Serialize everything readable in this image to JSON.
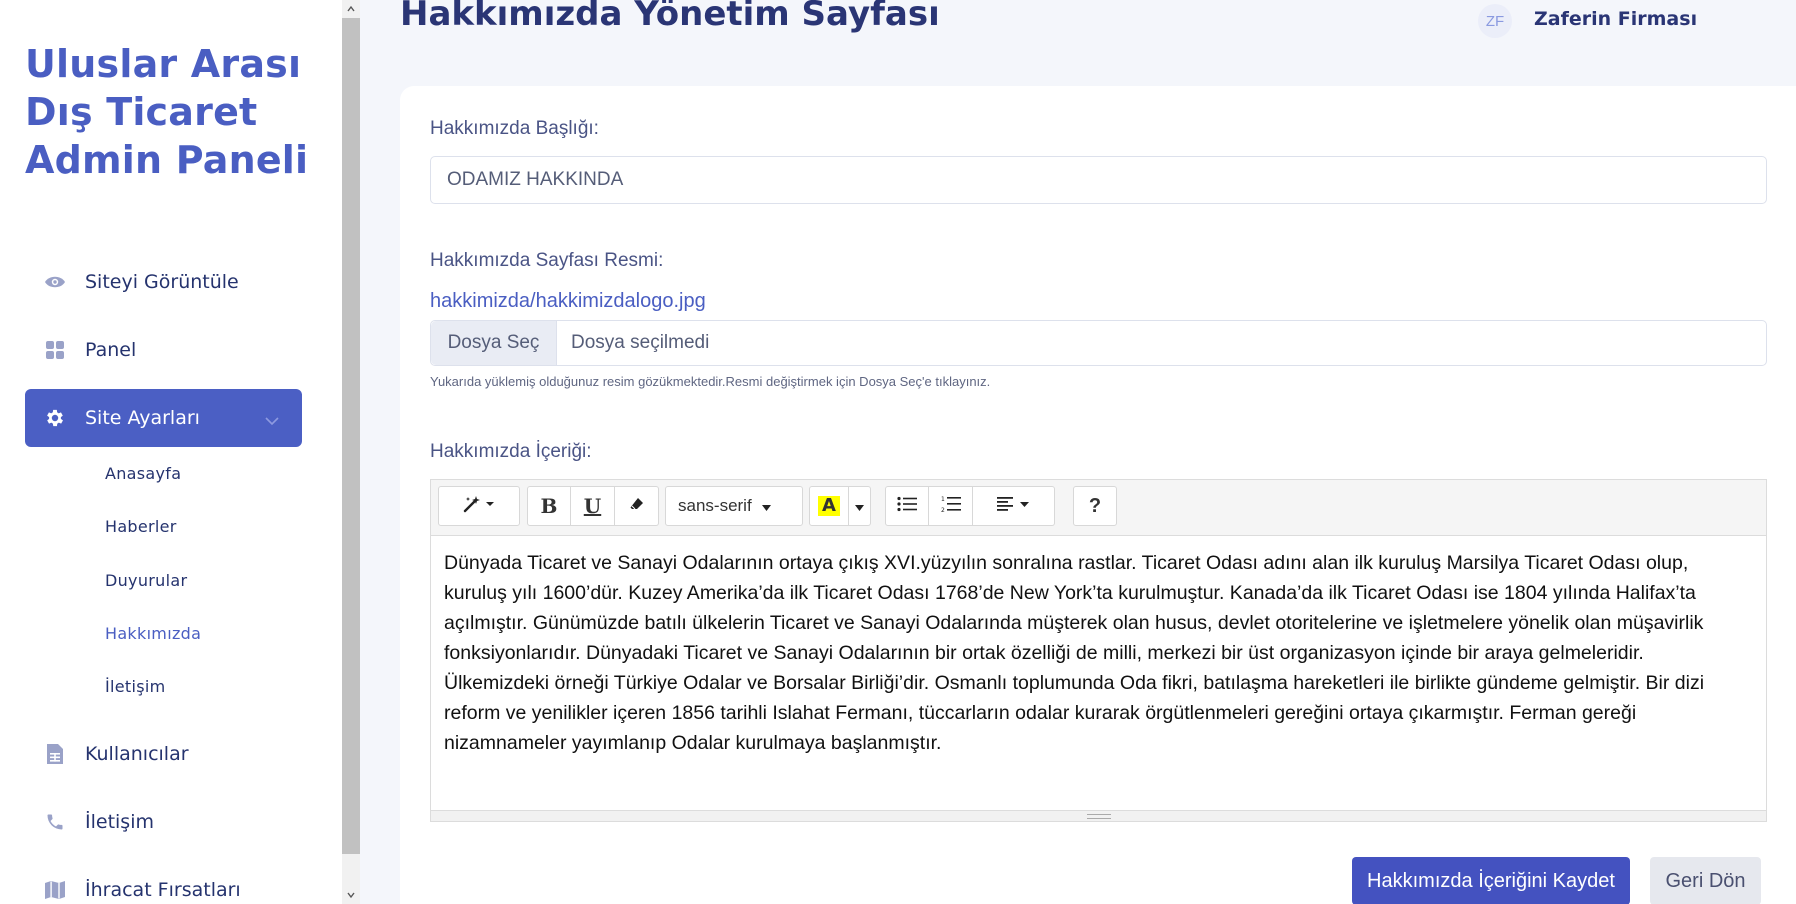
{
  "sidebar": {
    "brand": "Uluslar Arası Dış Ticaret Admin Paneli",
    "items": [
      {
        "label": "Siteyi Görüntüle",
        "icon": "eye-icon"
      },
      {
        "label": "Panel",
        "icon": "grid-icon"
      },
      {
        "label": "Site Ayarları",
        "icon": "gear-icon",
        "active": true
      },
      {
        "label": "Kullanıcılar",
        "icon": "document-table-icon"
      },
      {
        "label": "İletişim",
        "icon": "phone-icon"
      },
      {
        "label": "İhracat Fırsatları",
        "icon": "map-icon"
      }
    ],
    "subitems": [
      {
        "label": "Anasayfa"
      },
      {
        "label": "Haberler"
      },
      {
        "label": "Duyurular"
      },
      {
        "label": "Hakkımızda",
        "current": true
      },
      {
        "label": "İletişim"
      }
    ]
  },
  "header": {
    "title": "Hakkımızda Yönetim Sayfası",
    "user_initials": "ZF",
    "user_name": "Zaferin Firması"
  },
  "form": {
    "title_label": "Hakkımızda Başlığı:",
    "title_value": "ODAMIZ HAKKINDA",
    "image_label": "Hakkımızda Sayfası Resmi:",
    "image_path": "hakkimizda/hakkimizdalogo.jpg",
    "file_button": "Dosya Seç",
    "file_status": "Dosya seçilmedi",
    "help_text": "Yukarıda yüklemiş olduğunuz resim gözükmektedir.Resmi değiştirmek için Dosya Seç'e tıklayınız.",
    "content_label": "Hakkımızda İçeriği:"
  },
  "editor": {
    "font_name": "sans-serif",
    "help_label": "?",
    "bold_label": "B",
    "underline_label": "U",
    "color_label": "A",
    "content": "Dünyada Ticaret ve Sanayi Odalarının ortaya çıkış XVI.yüzyılın sonralına rastlar. Ticaret Odası adını alan ilk kuruluş Marsilya Ticaret Odası olup, kuruluş yılı 1600’dür. Kuzey Amerika’da ilk Ticaret Odası 1768’de New York’ta kurulmuştur. Kanada’da ilk Ticaret Odası ise 1804 yılında Halifax’ta açılmıştır. Günümüzde batılı ülkelerin Ticaret ve Sanayi Odalarında müşterek olan husus, devlet otoritelerine ve işletmelere yönelik olan müşavirlik fonksiyonlarıdır. Dünyadaki Ticaret ve Sanayi Odalarının bir ortak özelliği de milli, merkezi bir üst organizasyon içinde bir araya gelmeleridir. Ülkemizdeki örneği Türkiye Odalar ve Borsalar Birliği’dir. Osmanlı toplumunda Oda fikri, batılaşma hareketleri ile birlikte gündeme gelmiştir. Bir dizi reform ve yenilikler içeren 1856 tarihli Islahat Fermanı, tüccarların odalar kurarak örgütlenmeleri gereğini ortaya çıkarmıştır. Ferman gereği nizamnameler yayımlanıp Odalar kurulmaya başlanmıştır."
  },
  "actions": {
    "save_label": "Hakkımızda İçeriğini Kaydet",
    "back_label": "Geri Dön"
  },
  "colors": {
    "accent": "#4b5fc4",
    "brand_text": "#4a5ec2",
    "dark_text": "#2a3575",
    "background": "#f4f6fb",
    "highlight_yellow": "#ffff00"
  }
}
